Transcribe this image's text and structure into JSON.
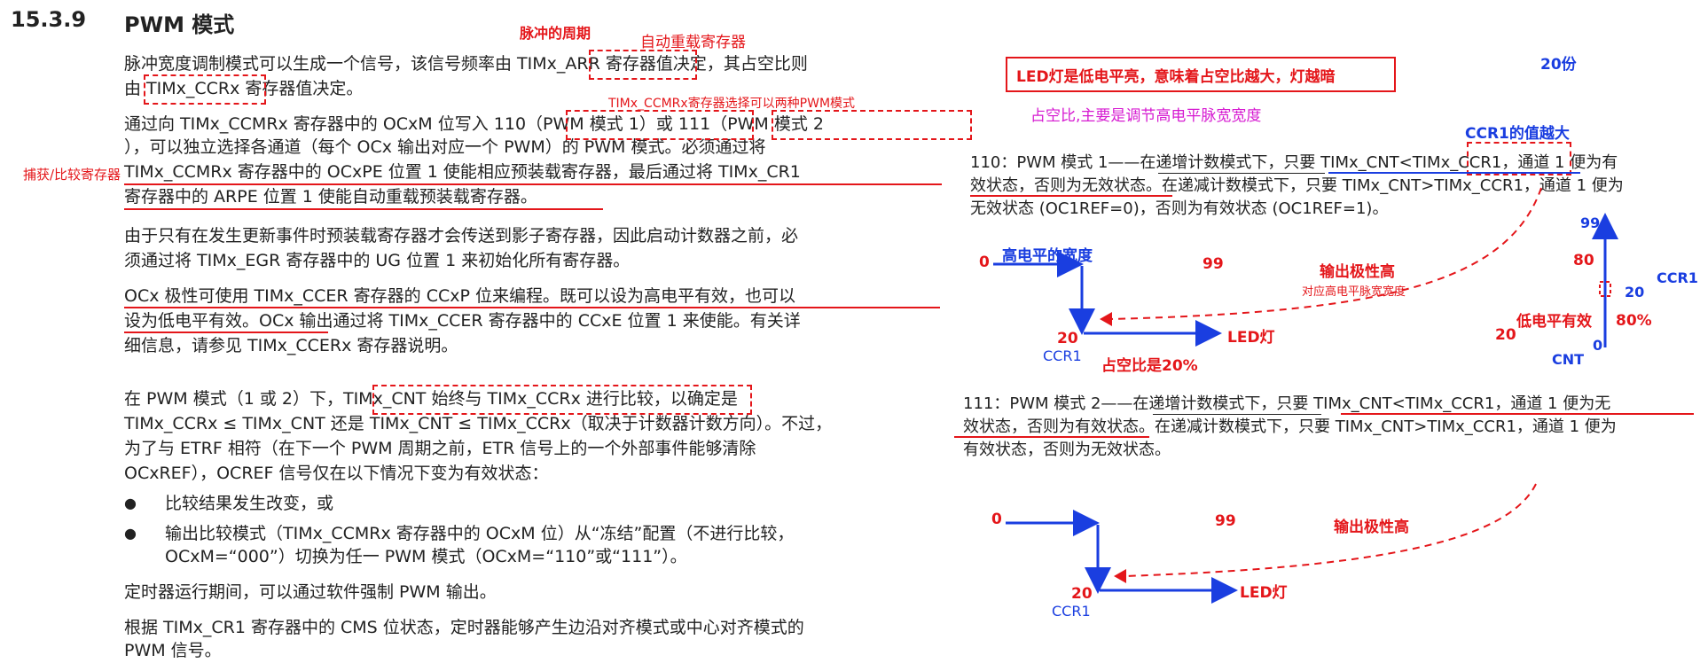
{
  "left": {
    "section_number": "15.3.9",
    "section_title": "PWM 模式",
    "p1_l1": "脉冲宽度调制模式可以生成一个信号，该信号频率由 TIMx_ARR 寄存器值决定，其占空比则",
    "p1_l2": "由 TIMx_CCRx 寄存器值决定。",
    "p2_l1": "通过向 TIMx_CCMRx 寄存器中的 OCxM 位写入 110（PWM 模式 1）或 111（PWM 模式 2",
    "p2_l2": "），可以独立选择各通道（每个 OCx 输出对应一个 PWM）的 PWM 模式。必须通过将",
    "p2_l3": "TIMx_CCMRx 寄存器中的 OCxPE 位置 1 使能相应预装载寄存器，最后通过将 TIMx_CR1",
    "p2_l4": "寄存器中的 ARPE 位置 1 使能自动重载预装载寄存器。",
    "p3_l1": "由于只有在发生更新事件时预装载寄存器才会传送到影子寄存器，因此启动计数器之前，必",
    "p3_l2": "须通过将 TIMx_EGR 寄存器中的 UG 位置 1 来初始化所有寄存器。",
    "p4_l1": "OCx 极性可使用 TIMx_CCER 寄存器的 CCxP 位来编程。既可以设为高电平有效，也可以",
    "p4_l2": "设为低电平有效。OCx 输出通过将 TIMx_CCER 寄存器中的 CCxE 位置 1 来使能。有关详",
    "p4_l3": "细信息，请参见 TIMx_CCERx 寄存器说明。",
    "p5_l1": "在 PWM 模式（1 或 2）下，TIMx_CNT 始终与 TIMx_CCRx 进行比较，以确定是",
    "p5_l2": "TIMx_CCRx ≤ TIMx_CNT 还是 TIMx_CNT ≤ TIMx_CCRx（取决于计数器计数方向）。不过，",
    "p5_l3": "为了与 ETRF 相符（在下一个 PWM 周期之前，ETR 信号上的一个外部事件能够清除",
    "p5_l4": "OCxREF），OCREF 信号仅在以下情况下变为有效状态：",
    "bullet_mark": "●",
    "b1": "比较结果发生改变，或",
    "b2_l1": "输出比较模式（TIMx_CCMRx 寄存器中的 OCxM 位）从“冻结”配置（不进行比较，",
    "b2_l2": "OCxM=“000”）切换为任一 PWM 模式（OCxM=“110”或“111”）。",
    "p6": "定时器运行期间，可以通过软件强制 PWM 输出。",
    "p7_l1": "根据 TIMx_CR1 寄存器中的 CMS 位状态，定时器能够产生边沿对齐模式或中心对齐模式的",
    "p7_l2": "PWM 信号。"
  },
  "annotations": {
    "pulse_period": "脉冲的周期",
    "auto_reload": "自动重载寄存器",
    "ccmr_select": "TIMx_CCMRx寄存器选择可以两种PWM模式",
    "capture_compare": "捕获/比较寄存器"
  },
  "right": {
    "led_note": "LED灯是低电平亮，意味着占空比越大，灯越暗",
    "twenty_parts": "20份",
    "duty_note": "占空比,主要是调节高电平脉宽宽度",
    "ccr1_larger": "CCR1的值越大",
    "m1_l1": "110：PWM 模式 1——在递增计数模式下，只要 TIMx_CNT<TIMx_CCR1，通道 1 便为有",
    "m1_l2": "效状态，否则为无效状态。在递减计数模式下，只要 TIMx_CNT>TIMx_CCR1，通道 1 便为",
    "m1_l3": "无效状态 (OC1REF=0)，否则为有效状态 (OC1REF=1)。",
    "d1_zero": "0",
    "d1_high_width": "高电平的宽度",
    "d1_99": "99",
    "d1_polarity": "输出极性高",
    "d1_pulse_width": "对应高电平脉宽宽度",
    "d1_20": "20",
    "d1_ccr1": "CCR1",
    "d1_led": "LED灯",
    "d1_duty": "占空比是20%",
    "g_99": "99",
    "g_80": "80",
    "g_20": "20",
    "g_ccr1": "CCR1",
    "g_low_active": "低电平有效",
    "g_80pct": "80%",
    "g_20_red": "20",
    "g_0": "0",
    "g_cnt": "CNT",
    "m2_l1": "111：PWM 模式 2——在递增计数模式下，只要 TIMx_CNT<TIMx_CCR1，通道 1 便为无",
    "m2_l2": "效状态，否则为有效状态。在递减计数模式下，只要 TIMx_CNT>TIMx_CCR1，通道 1 便为",
    "m2_l3": "有效状态，否则为无效状态。",
    "d2_zero": "0",
    "d2_99": "99",
    "d2_polarity": "输出极性高",
    "d2_20": "20",
    "d2_ccr1": "CCR1",
    "d2_led": "LED灯"
  },
  "colors": {
    "red": "#e4161a",
    "blue": "#1a3ee0",
    "magenta": "#d61ad1"
  }
}
